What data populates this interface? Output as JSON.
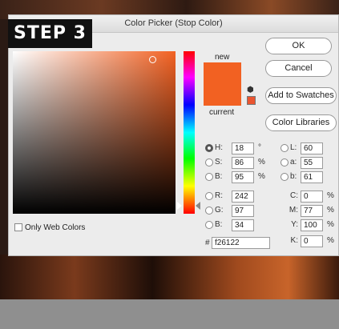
{
  "dialog": {
    "title": "Color Picker (Stop Color)",
    "new_label": "new",
    "current_label": "current",
    "new_color": "#f26122",
    "current_color": "#f26122",
    "hex_prefix": "#",
    "hex_value": "f26122",
    "only_web_colors": "Only Web Colors"
  },
  "buttons": {
    "ok": "OK",
    "cancel": "Cancel",
    "add_to_swatches": "Add to Swatches",
    "color_libraries": "Color Libraries"
  },
  "overlay": {
    "step": "STEP 3"
  },
  "hsb": [
    {
      "label": "H:",
      "value": "18",
      "unit": "°",
      "selected": true
    },
    {
      "label": "S:",
      "value": "86",
      "unit": "%",
      "selected": false
    },
    {
      "label": "B:",
      "value": "95",
      "unit": "%",
      "selected": false
    }
  ],
  "rgb": [
    {
      "label": "R:",
      "value": "242"
    },
    {
      "label": "G:",
      "value": "97"
    },
    {
      "label": "B:",
      "value": "34"
    }
  ],
  "lab": [
    {
      "label": "L:",
      "value": "60"
    },
    {
      "label": "a:",
      "value": "55"
    },
    {
      "label": "b:",
      "value": "61"
    }
  ],
  "cmyk": [
    {
      "label": "C:",
      "value": "0",
      "unit": "%"
    },
    {
      "label": "M:",
      "value": "77",
      "unit": "%"
    },
    {
      "label": "Y:",
      "value": "100",
      "unit": "%"
    },
    {
      "label": "K:",
      "value": "0",
      "unit": "%"
    }
  ],
  "icons": {
    "gamut": "cube-icon",
    "sv_marker": "color-marker-icon"
  }
}
